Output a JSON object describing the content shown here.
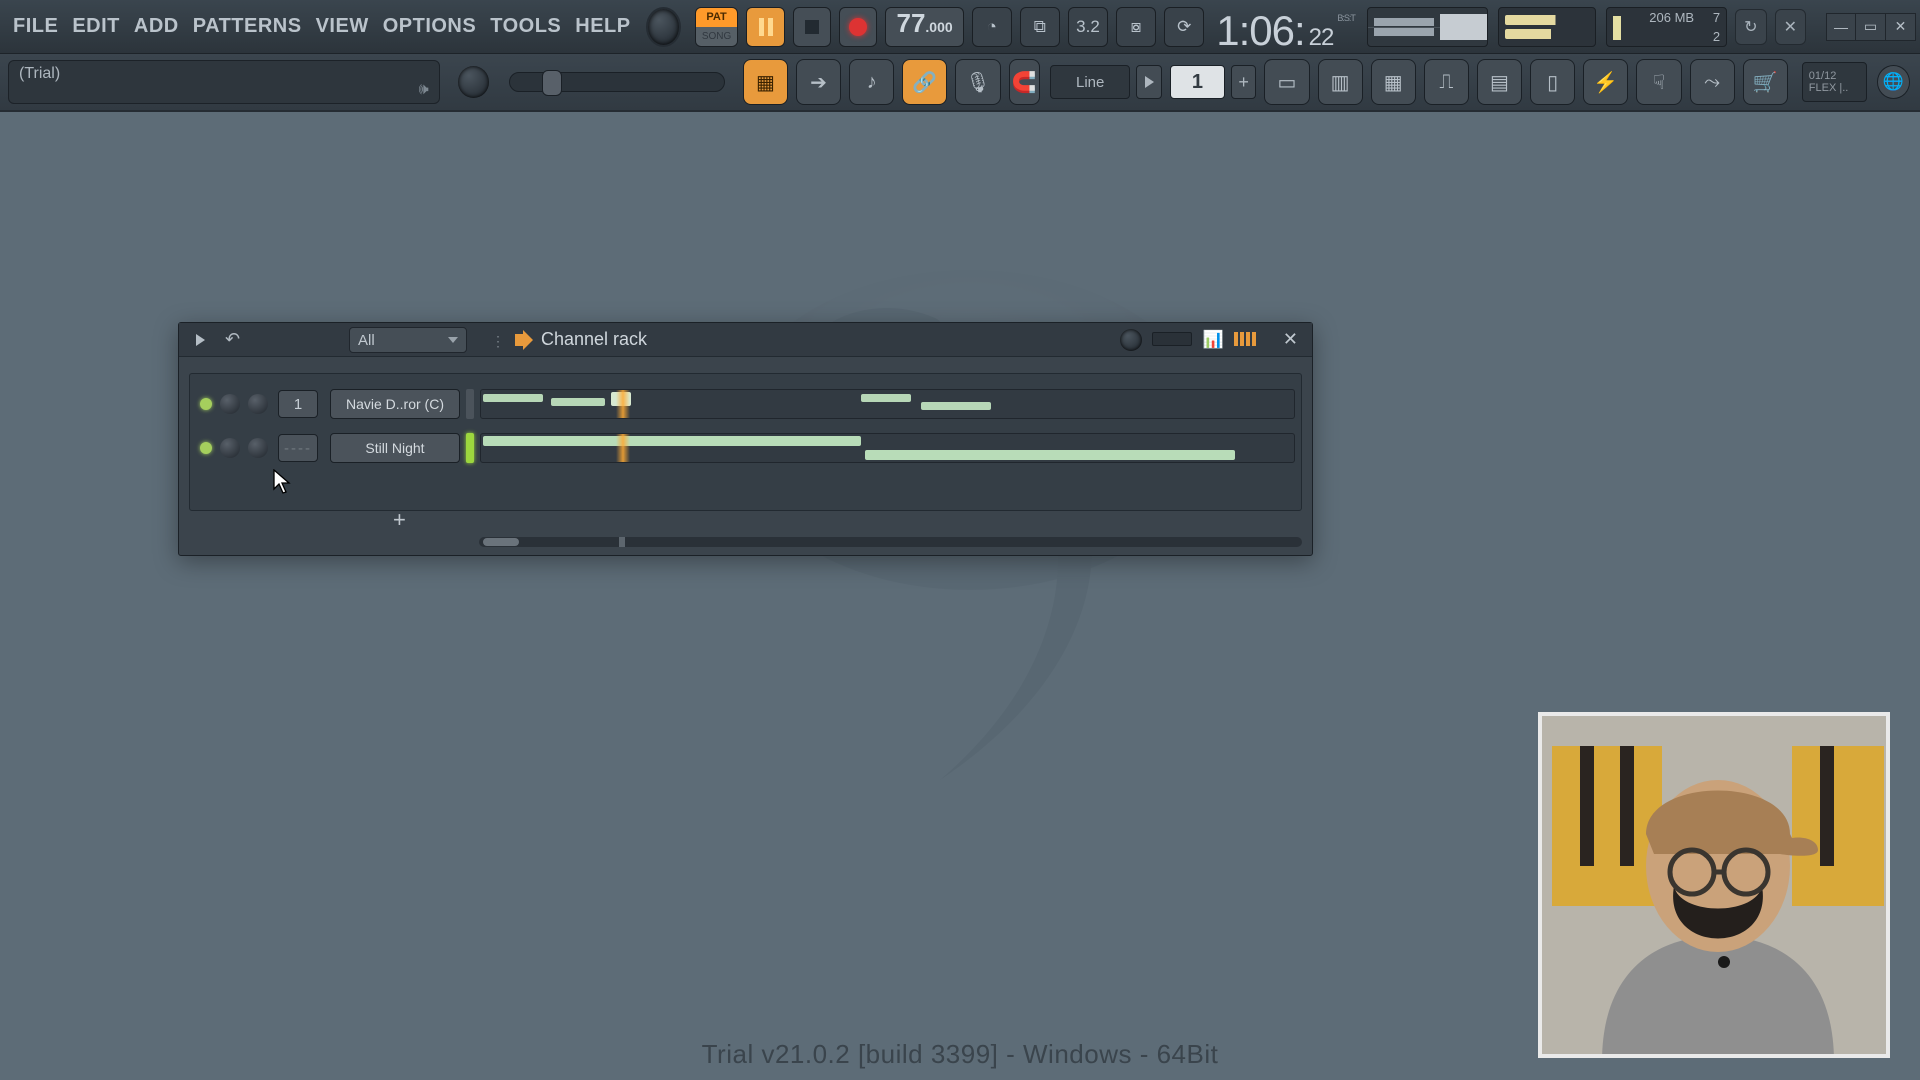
{
  "menu": {
    "file": "FILE",
    "edit": "EDIT",
    "add": "ADD",
    "patterns": "PATTERNS",
    "view": "VIEW",
    "options": "OPTIONS",
    "tools": "TOOLS",
    "help": "HELP"
  },
  "transport": {
    "pat_label": "PAT",
    "song_label": "SONG",
    "tempo_int": "77",
    "tempo_dec": ".000",
    "time_mode": "B:S:T",
    "time_big1": "1",
    "time_big2": "06",
    "time_sub": "22",
    "sig_label": "3.2",
    "cpu_poly": "7",
    "cpu_mb": "206 MB",
    "cpu_two": "2"
  },
  "toolbar": {
    "hint": "(Trial)",
    "snap_label": "Line",
    "pattern_number": "1",
    "plus": "+",
    "flex_top": "01/12",
    "flex_bottom": "FLEX |.."
  },
  "channel_rack": {
    "title": "Channel rack",
    "filter": "All",
    "add": "+",
    "close": "✕",
    "rows": [
      {
        "route": "1",
        "route_class": "",
        "name": "Navie D..ror (C)",
        "activity": "off"
      },
      {
        "route": "----",
        "route_class": "blank",
        "name": "Still Night",
        "activity": "on"
      }
    ]
  },
  "footer": {
    "trial": "Trial v21.0.2 [build 3399] - Windows - 64Bit"
  }
}
